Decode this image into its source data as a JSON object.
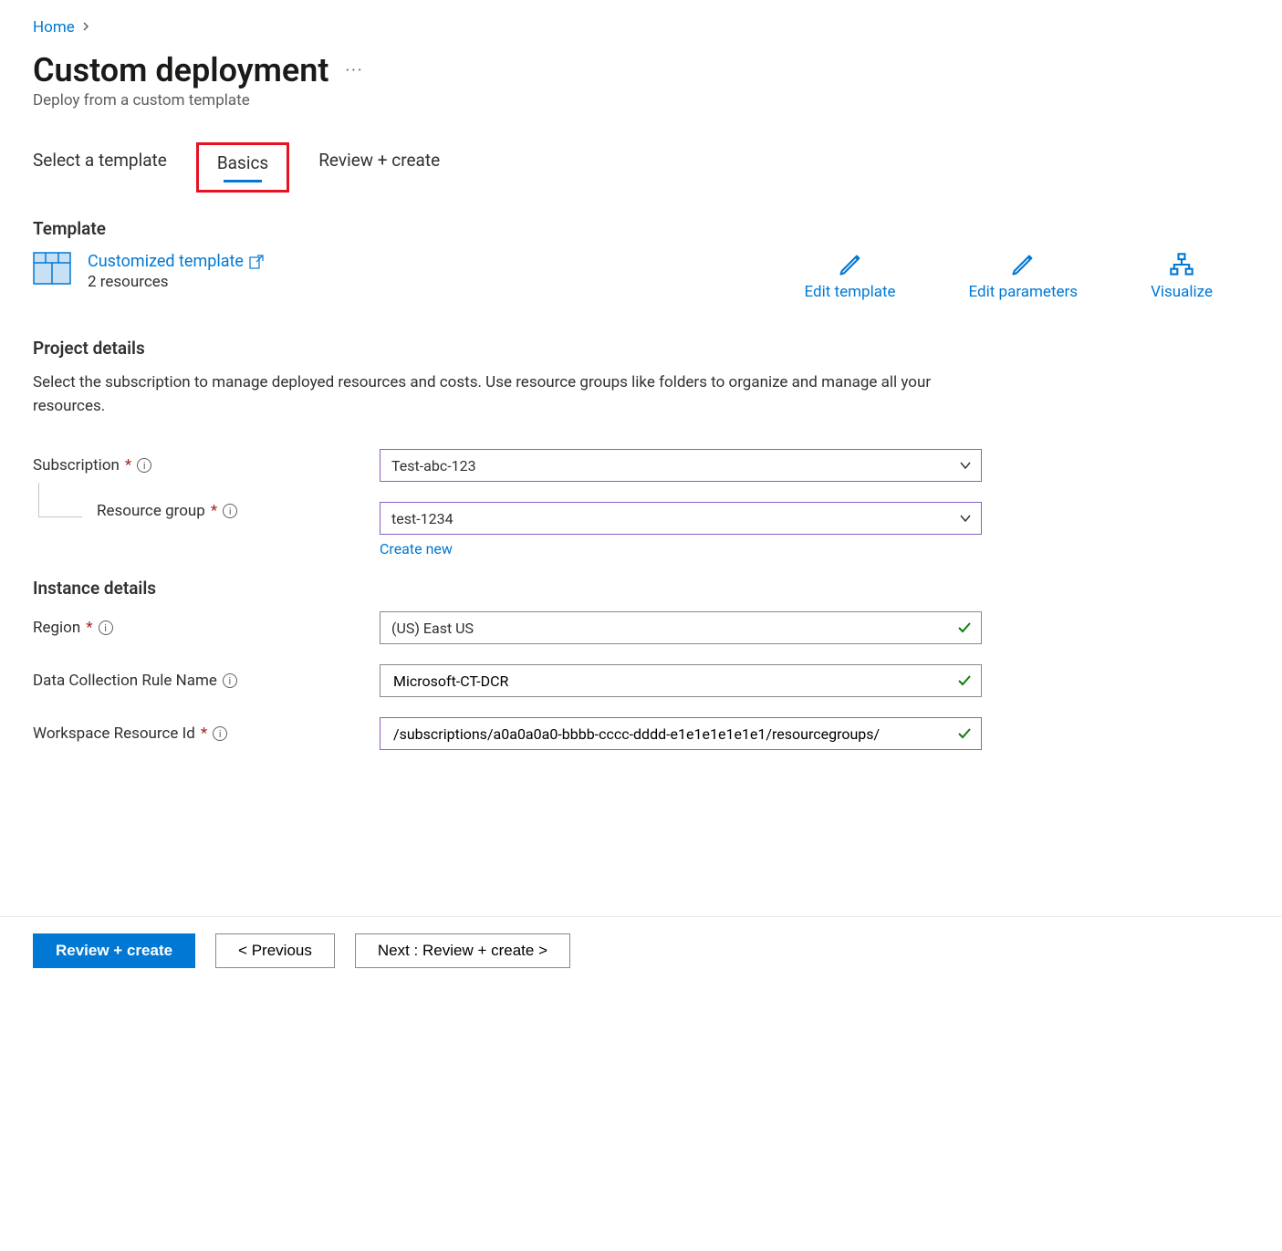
{
  "breadcrumb": {
    "home": "Home"
  },
  "header": {
    "title": "Custom deployment",
    "subtitle": "Deploy from a custom template"
  },
  "tabs": {
    "select_template": "Select a template",
    "basics": "Basics",
    "review_create": "Review + create"
  },
  "template": {
    "section_title": "Template",
    "link_label": "Customized template",
    "resources_text": "2 resources",
    "actions": {
      "edit_template": "Edit template",
      "edit_parameters": "Edit parameters",
      "visualize": "Visualize"
    }
  },
  "project_details": {
    "section_title": "Project details",
    "description": "Select the subscription to manage deployed resources and costs. Use resource groups like folders to organize and manage all your resources.",
    "subscription_label": "Subscription",
    "subscription_value": "Test-abc-123",
    "resource_group_label": "Resource group",
    "resource_group_value": "test-1234",
    "create_new": "Create new"
  },
  "instance_details": {
    "section_title": "Instance details",
    "region_label": "Region",
    "region_value": "(US) East US",
    "dcr_label": "Data Collection Rule Name",
    "dcr_value": "Microsoft-CT-DCR",
    "workspace_label": "Workspace Resource Id",
    "workspace_value": "/subscriptions/a0a0a0a0-bbbb-cccc-dddd-e1e1e1e1e1e1/resourcegroups/"
  },
  "footer": {
    "review_create": "Review + create",
    "previous": "< Previous",
    "next": "Next : Review + create >"
  }
}
